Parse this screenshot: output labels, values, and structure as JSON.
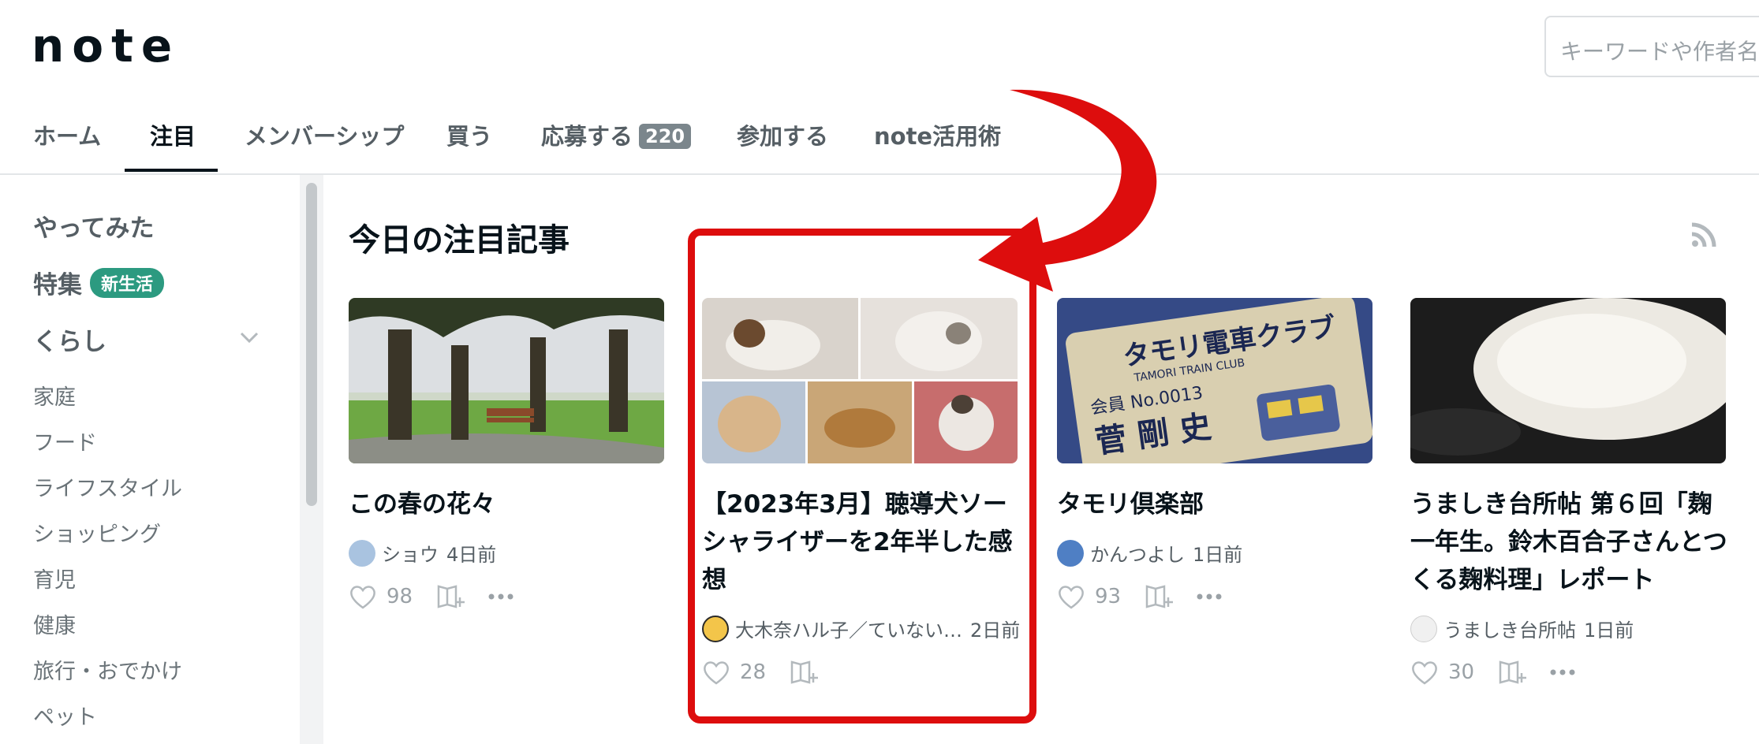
{
  "header": {
    "logo_text": "note",
    "search": {
      "placeholder": "キーワードや作者名"
    }
  },
  "tabs": [
    {
      "label": "ホーム",
      "active": false
    },
    {
      "label": "注目",
      "active": true
    },
    {
      "label": "メンバーシップ",
      "active": false
    },
    {
      "label": "買う",
      "active": false
    },
    {
      "label": "応募する",
      "count": "220",
      "active": false
    },
    {
      "label": "参加する",
      "active": false
    },
    {
      "label": "note活用術",
      "active": false
    }
  ],
  "sidebar": {
    "headings": [
      {
        "label": "やってみた"
      },
      {
        "label": "特集",
        "badge": "新生活"
      },
      {
        "label": "くらし",
        "expanded": true
      }
    ],
    "items": [
      "家庭",
      "フード",
      "ライフスタイル",
      "ショッピング",
      "育児",
      "健康",
      "旅行・おでかけ",
      "ペット"
    ]
  },
  "main": {
    "section_title": "今日の注目記事",
    "cards": [
      {
        "title": "この春の花々",
        "author": "ショウ",
        "time": "4日前",
        "likes": "98",
        "image": "park-cherry-trees-bench"
      },
      {
        "title": "【2023年3月】聴導犬ソーシャライザーを2年半した感想",
        "author": "大木奈ハル子／ていない…",
        "time": "2日前",
        "likes": "28",
        "image": "dog-photo-collage"
      },
      {
        "title": "タモリ倶楽部",
        "author": "かんつよし",
        "time": "1日前",
        "likes": "93",
        "image": "tamori-train-club-card",
        "image_text": {
          "line1": "タモリ電車クラブ",
          "line2": "TAMORI TRAIN CLUB",
          "line3": "会員 No.0013",
          "line4": "菅 剛 史"
        }
      },
      {
        "title": "うましき台所帖 第６回「麹一年生。鈴木百合子さんとつくる麹料理」レポート",
        "author": "うましき台所帖",
        "time": "1日前",
        "likes": "30",
        "image": "koji-rice-closeup"
      }
    ]
  },
  "annotation": {
    "color": "#dd0d0d"
  },
  "colors": {
    "badge_green": "#2c9a80",
    "count_badge": "#7b868c",
    "text_primary": "#08131a"
  }
}
